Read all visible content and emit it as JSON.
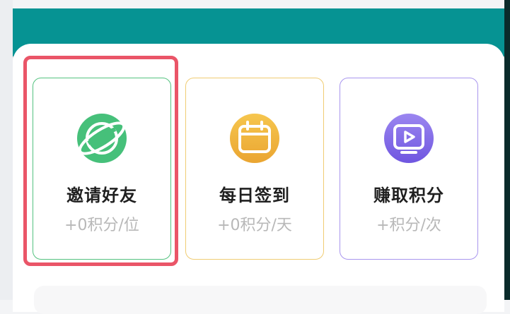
{
  "colors": {
    "header": "#069393",
    "invite_border": "#53c27f",
    "checkin_border": "#f0cc73",
    "earn_border": "#a895ee",
    "highlight": "#ea5568"
  },
  "cards": [
    {
      "title": "邀请好友",
      "subtitle": "+0积分/位",
      "icon": "planet-icon"
    },
    {
      "title": "每日签到",
      "subtitle": "+0积分/天",
      "icon": "calendar-icon"
    },
    {
      "title": "赚取积分",
      "subtitle": "+积分/次",
      "icon": "video-play-icon"
    }
  ]
}
